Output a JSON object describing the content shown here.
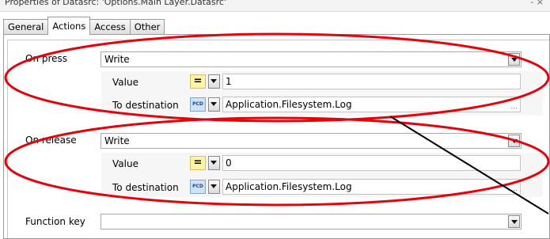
{
  "window": {
    "title": "Properties of Datasrc: 'Options.Main Layer.Datasrc'",
    "controls": "- ×"
  },
  "tabs": [
    {
      "label": "General",
      "active": false
    },
    {
      "label": "Actions",
      "active": true
    },
    {
      "label": "Access",
      "active": false
    },
    {
      "label": "Other",
      "active": false
    }
  ],
  "on_press": {
    "label": "On press",
    "action": "Write",
    "value_label": "Value",
    "operator": "=",
    "value": "1",
    "dest_label": "To destination",
    "dest_type": "PCD",
    "destination": "Application.Filesystem.Log",
    "browse": "..."
  },
  "on_release": {
    "label": "On release",
    "action": "Write",
    "value_label": "Value",
    "operator": "=",
    "value": "0",
    "dest_label": "To destination",
    "dest_type": "PCD",
    "destination": "Application.Filesystem.Log",
    "browse": "..."
  },
  "function_key": {
    "label": "Function key",
    "value": ""
  },
  "annotation_color": "#e8000a"
}
